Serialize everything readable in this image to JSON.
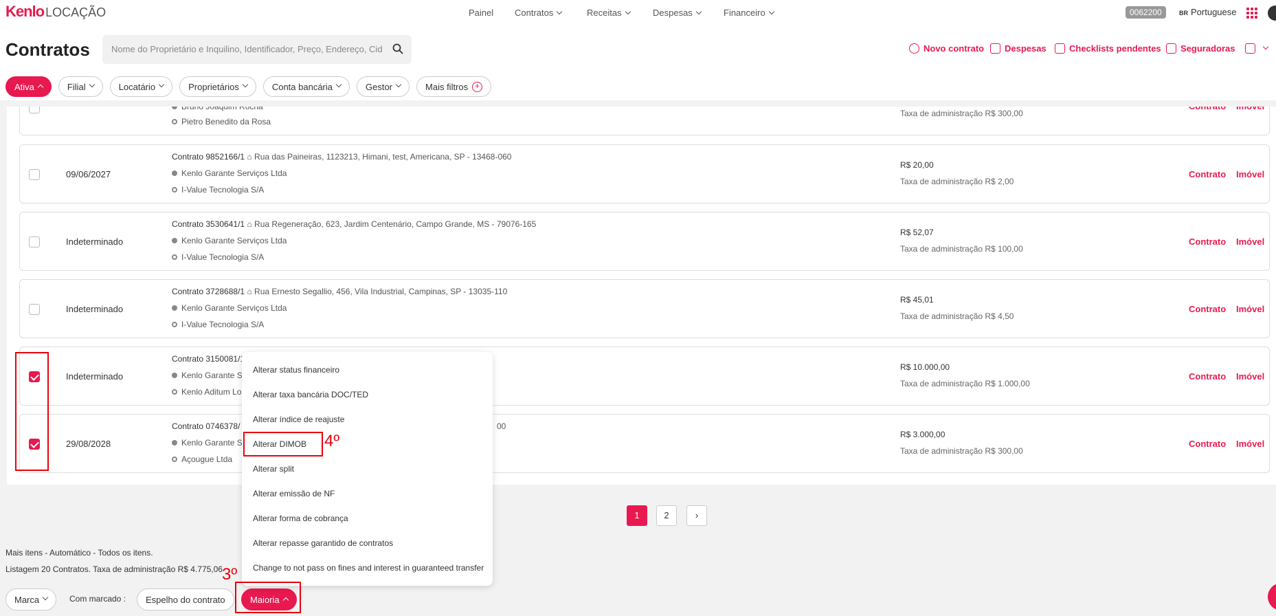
{
  "brand": {
    "name": "Kenlo",
    "product": "LOCAÇÃO"
  },
  "nav": [
    {
      "label": "Painel",
      "dropdown": false
    },
    {
      "label": "Contratos",
      "dropdown": true
    },
    {
      "label": "Receitas",
      "dropdown": true
    },
    {
      "label": "Despesas",
      "dropdown": true
    },
    {
      "label": "Financeiro",
      "dropdown": true
    }
  ],
  "account": {
    "code": "0062200",
    "flag": "BR",
    "language": "Portuguese"
  },
  "page": {
    "title": "Contratos"
  },
  "search": {
    "placeholder": "Nome do Proprietário e Inquilino, Identificador, Preço, Endereço, Cida"
  },
  "actions": [
    {
      "label": "Novo contrato",
      "icon": "plus-circle-icon"
    },
    {
      "label": "Despesas",
      "icon": "wallet-icon"
    },
    {
      "label": "Checklists pendentes",
      "icon": "checklist-icon"
    },
    {
      "label": "Seguradoras",
      "icon": "shield-check-icon"
    }
  ],
  "filters": [
    "Ativa",
    "Filial",
    "Locatário",
    "Proprietários",
    "Conta bancária",
    "Gestor",
    "Mais filtros"
  ],
  "rows": [
    {
      "date": "",
      "contract": "",
      "address": "",
      "tenant": "Bruno Joaquim Rocha",
      "owner": "Pietro Benedito da Rosa",
      "value": "",
      "tax": "Taxa de administração R$ 300,00",
      "checked": false
    },
    {
      "date": "09/06/2027",
      "contract": "Contrato 9852166/1",
      "address": "Rua das Paineiras, 1123213, Himani, test, Americana, SP - 13468-060",
      "tenant": "Kenlo Garante Serviços Ltda",
      "owner": "I-Value Tecnologia S/A",
      "value": "R$ 20,00",
      "tax": "Taxa de administração R$ 2,00",
      "checked": false
    },
    {
      "date": "Indeterminado",
      "contract": "Contrato 3530641/1",
      "address": "Rua Regeneração, 623, Jardim Centenário, Campo Grande, MS - 79076-165",
      "tenant": "Kenlo Garante Serviços Ltda",
      "owner": "I-Value Tecnologia S/A",
      "value": "R$ 52,07",
      "tax": "Taxa de administração R$ 100,00",
      "checked": false
    },
    {
      "date": "Indeterminado",
      "contract": "Contrato 3728688/1",
      "address": "Rua Ernesto Segallio, 456, Vila Industrial, Campinas, SP - 13035-110",
      "tenant": "Kenlo Garante Serviços Ltda",
      "owner": "I-Value Tecnologia S/A",
      "value": "R$ 45,01",
      "tax": "Taxa de administração R$ 4,50",
      "checked": false
    },
    {
      "date": "Indeterminado",
      "contract": "Contrato 3150081/1",
      "address": "",
      "tenant": "Kenlo Garante Se",
      "owner": "Kenlo Aditum Lo",
      "value": "R$ 10.000,00",
      "tax": "Taxa de administração R$ 1.000,00",
      "checked": true
    },
    {
      "date": "29/08/2028",
      "contract": "Contrato 0746378/",
      "address": "00",
      "tenant": "Kenlo Garante Se",
      "owner": "Açougue Ltda",
      "value": "R$ 3.000,00",
      "tax": "Taxa de administração R$ 300,00",
      "checked": true
    }
  ],
  "row_links": {
    "contract": "Contrato",
    "property": "Imóvel"
  },
  "menu": [
    "Alterar status financeiro",
    "Alterar taxa bancária DOC/TED",
    "Alterar índice de reajuste",
    "Alterar DIMOB",
    "Alterar split",
    "Alterar emissão de NF",
    "Alterar forma de cobrança",
    "Alterar repasse garantido de contratos",
    "Change to not pass on fines and interest in guaranteed transfer"
  ],
  "pagination": {
    "pages": [
      "1",
      "2"
    ],
    "current": "1",
    "next": "›"
  },
  "footer": {
    "line1": "Mais itens - Automático - Todos os itens.",
    "line2": "Listagem 20 Contratos. Taxa de administração R$ 4.775,06",
    "mark_label": "Marca",
    "with_marked": "Com marcado :",
    "mirror_button": "Espelho do contrato",
    "more_button": "Maioria"
  },
  "annotations": {
    "step3": "3º",
    "step4": "4º"
  },
  "colors": {
    "accent": "#e8194f",
    "annotation": "#e8000c"
  }
}
